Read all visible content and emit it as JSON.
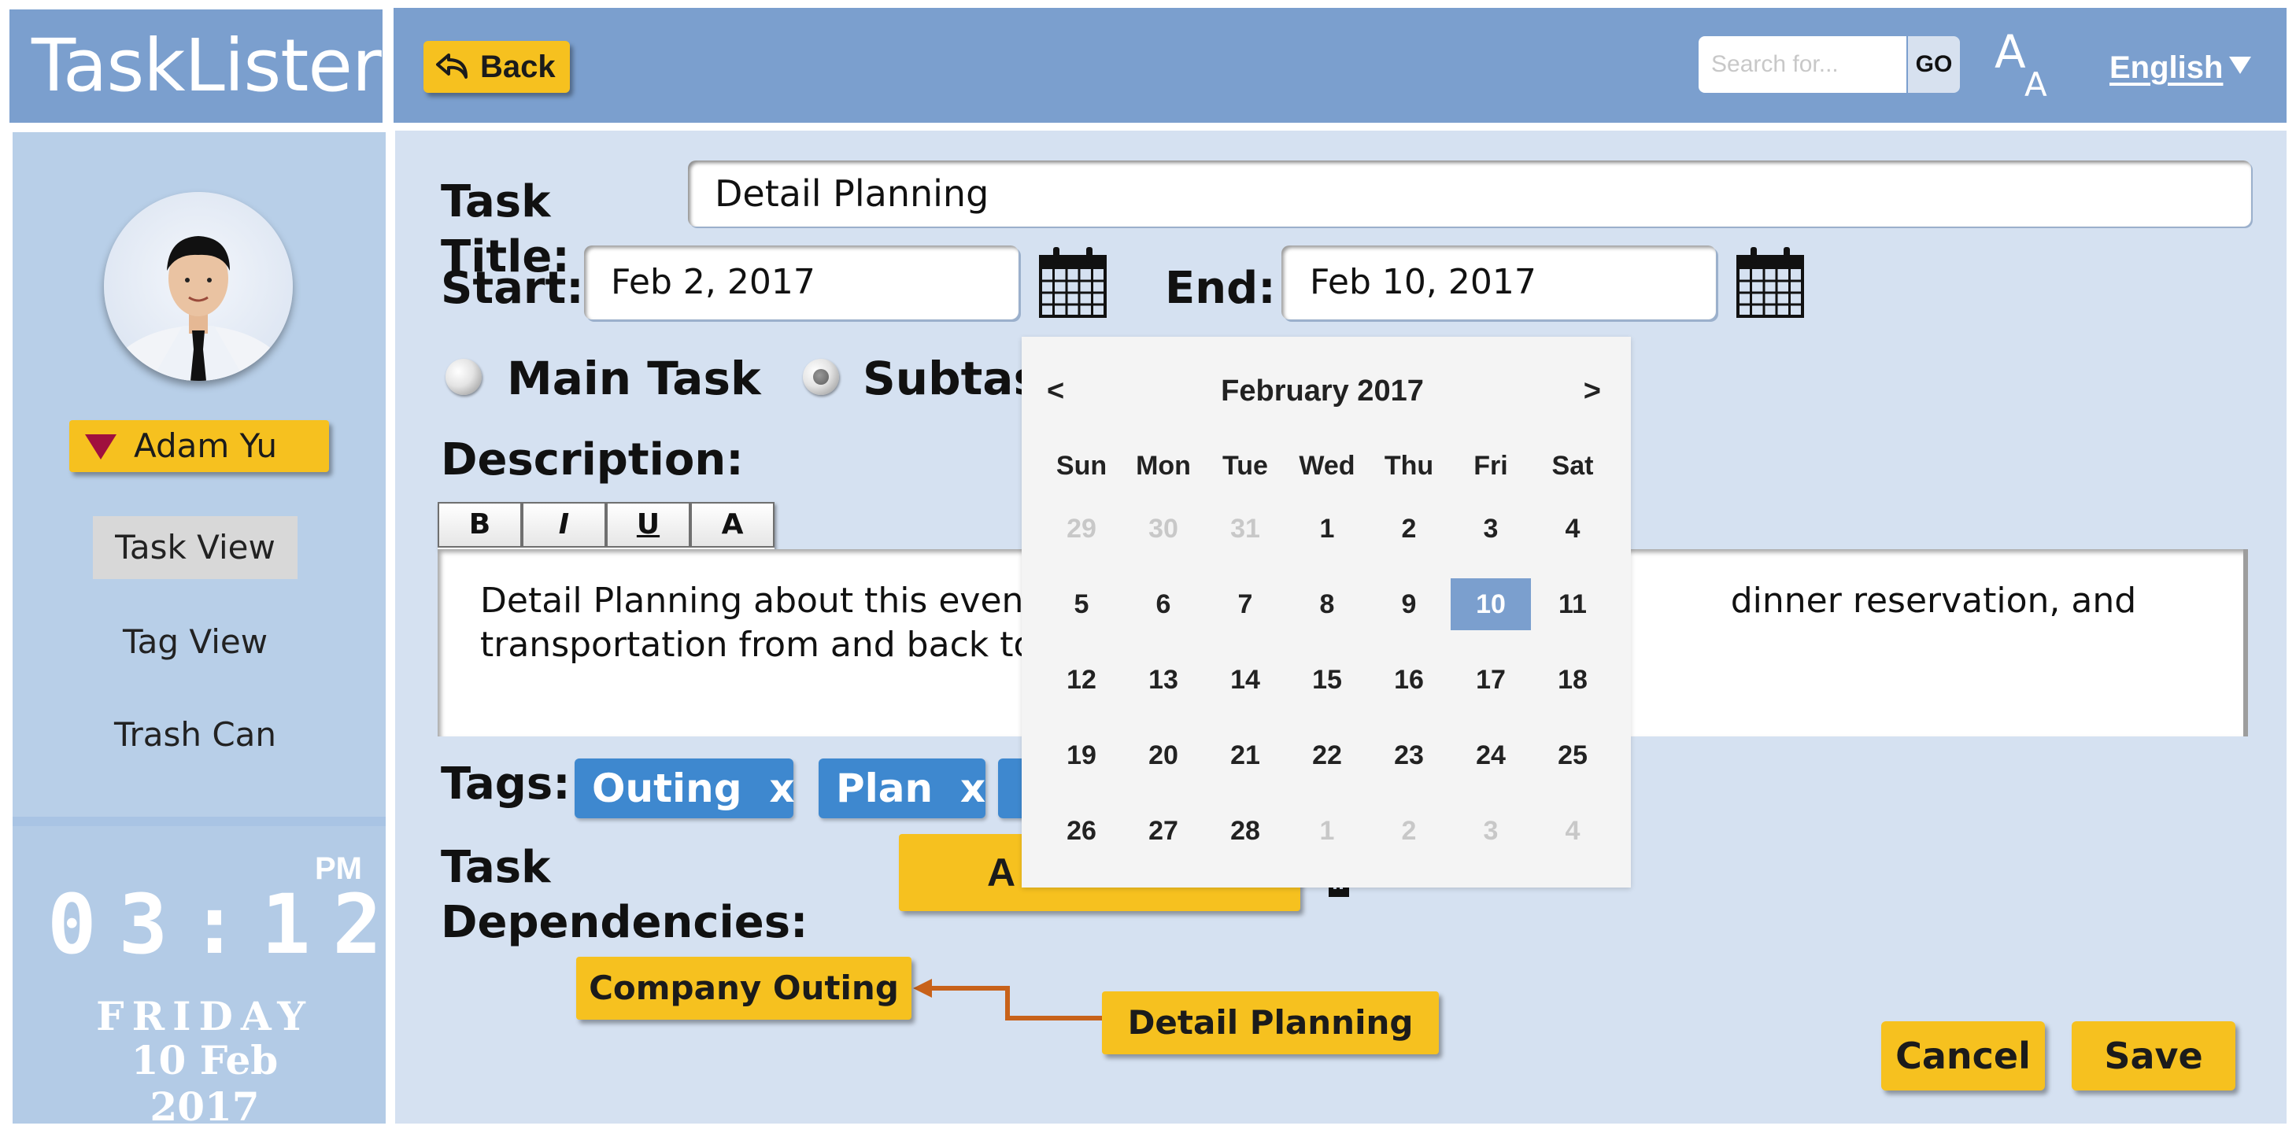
{
  "app": {
    "name": "TaskLister"
  },
  "header": {
    "back_label": "Back",
    "search_placeholder": "Search for...",
    "go_label": "GO",
    "language": "English"
  },
  "sidebar": {
    "user_name": "Adam Yu",
    "items": [
      {
        "label": "Task View",
        "active": true
      },
      {
        "label": "Tag View",
        "active": false
      },
      {
        "label": "Trash Can",
        "active": false
      }
    ],
    "clock": {
      "time": "03:12",
      "ampm": "PM",
      "day": "FRIDAY",
      "date": "10 Feb 2017"
    }
  },
  "form": {
    "title_label": "Task Title:",
    "title_value": "Detail Planning",
    "start_label": "Start:",
    "start_value": "Feb 2, 2017",
    "end_label": "End:",
    "end_value": "Feb 10, 2017",
    "main_task_label": "Main Task",
    "subtask_label": "Subtask",
    "selected_type": "subtask",
    "description_label": "Description:",
    "format_buttons": [
      "B",
      "I",
      "U",
      "A"
    ],
    "description_text": "Detail Planning about this event. S                                                           dinner reservation, and transportation from and back to c",
    "tags_label": "Tags:",
    "tags": [
      {
        "label": "Outing  x"
      },
      {
        "label": "Plan  x"
      },
      {
        "label": ""
      }
    ],
    "dependencies_label": "Task Dependencies:",
    "add_dependency_label": "A",
    "dependency_nodes": {
      "parent": "Company Outing",
      "child": "Detail Planning"
    },
    "cancel_label": "Cancel",
    "save_label": "Save"
  },
  "date_picker": {
    "month_label": "February 2017",
    "prev": "<",
    "next": ">",
    "weekdays": [
      "Sun",
      "Mon",
      "Tue",
      "Wed",
      "Thu",
      "Fri",
      "Sat"
    ],
    "weeks": [
      [
        {
          "d": "29",
          "m": true
        },
        {
          "d": "30",
          "m": true
        },
        {
          "d": "31",
          "m": true
        },
        {
          "d": "1"
        },
        {
          "d": "2"
        },
        {
          "d": "3"
        },
        {
          "d": "4"
        }
      ],
      [
        {
          "d": "5"
        },
        {
          "d": "6"
        },
        {
          "d": "7"
        },
        {
          "d": "8"
        },
        {
          "d": "9"
        },
        {
          "d": "10",
          "sel": true
        },
        {
          "d": "11"
        }
      ],
      [
        {
          "d": "12"
        },
        {
          "d": "13"
        },
        {
          "d": "14"
        },
        {
          "d": "15"
        },
        {
          "d": "16"
        },
        {
          "d": "17"
        },
        {
          "d": "18"
        }
      ],
      [
        {
          "d": "19"
        },
        {
          "d": "20"
        },
        {
          "d": "21"
        },
        {
          "d": "22"
        },
        {
          "d": "23"
        },
        {
          "d": "24"
        },
        {
          "d": "25"
        }
      ],
      [
        {
          "d": "26"
        },
        {
          "d": "27"
        },
        {
          "d": "28"
        },
        {
          "d": "1",
          "m": true
        },
        {
          "d": "2",
          "m": true
        },
        {
          "d": "3",
          "m": true
        },
        {
          "d": "4",
          "m": true
        }
      ]
    ]
  },
  "colors": {
    "header_blue": "#7b9fce",
    "sidebar_blue": "#b8cfe8",
    "main_bg": "#d5e1f1",
    "accent_yellow": "#f6c11f",
    "tag_blue": "#3e88cf",
    "arrow_orange": "#c8621a"
  }
}
